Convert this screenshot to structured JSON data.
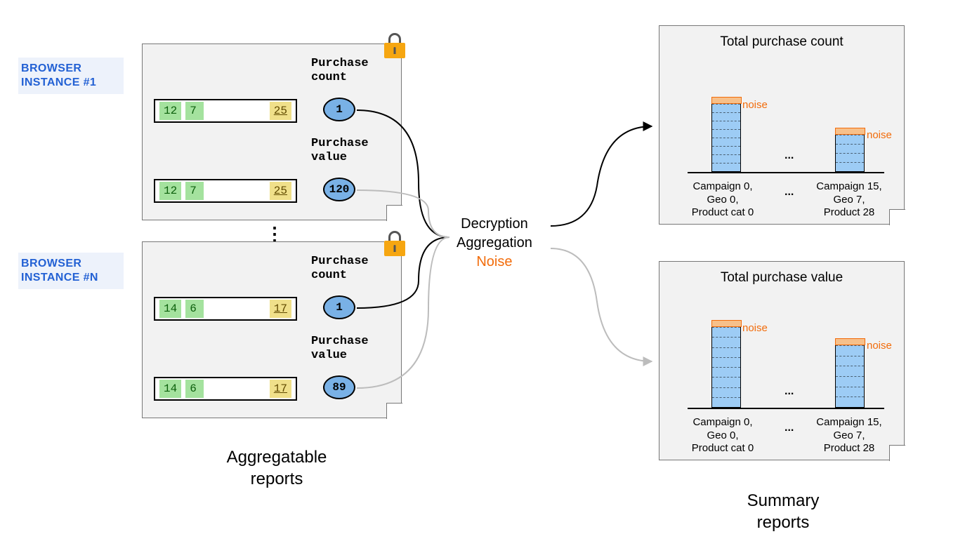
{
  "browsers": [
    {
      "label_line1": "BROWSER",
      "label_line2": "INSTANCE #1"
    },
    {
      "label_line1": "BROWSER",
      "label_line2": "INSTANCE #N"
    }
  ],
  "reports": [
    {
      "row1": {
        "a": "12",
        "b": "7",
        "c": "25"
      },
      "row2": {
        "a": "12",
        "b": "7",
        "c": "25"
      },
      "metric1_label": "Purchase\ncount",
      "metric1_value": "1",
      "metric2_label": "Purchase\nvalue",
      "metric2_value": "120"
    },
    {
      "row1": {
        "a": "14",
        "b": "6",
        "c": "17"
      },
      "row2": {
        "a": "14",
        "b": "6",
        "c": "17"
      },
      "metric1_label": "Purchase\ncount",
      "metric1_value": "1",
      "metric2_label": "Purchase\nvalue",
      "metric2_value": "89"
    }
  ],
  "left_caption": "Aggregatable\nreports",
  "middle": {
    "line1": "Decryption",
    "line2": "Aggregation",
    "line3": "Noise"
  },
  "summary": [
    {
      "title": "Total purchase count",
      "noise": "noise",
      "cat_left": "Campaign 0,\nGeo 0,\nProduct cat 0",
      "cat_right": "Campaign 15,\nGeo 7,\nProduct 28",
      "ellipsis": "...",
      "cat_ellipsis": "..."
    },
    {
      "title": "Total purchase value",
      "noise": "noise",
      "cat_left": "Campaign 0,\nGeo 0,\nProduct cat 0",
      "cat_right": "Campaign 15,\nGeo 7,\nProduct 28",
      "ellipsis": "...",
      "cat_ellipsis": "..."
    }
  ],
  "right_caption": "Summary\nreports",
  "chart_data": [
    {
      "type": "bar",
      "title": "Total purchase count",
      "categories": [
        "Campaign 0, Geo 0, Product cat 0",
        "Campaign 15, Geo 7, Product 28"
      ],
      "values_relative": [
        100,
        55
      ],
      "noise_overlay": true,
      "xlabel": "",
      "ylabel": ""
    },
    {
      "type": "bar",
      "title": "Total purchase value",
      "categories": [
        "Campaign 0, Geo 0, Product cat 0",
        "Campaign 15, Geo 7, Product 28"
      ],
      "values_relative": [
        100,
        78
      ],
      "noise_overlay": true,
      "xlabel": "",
      "ylabel": ""
    }
  ]
}
